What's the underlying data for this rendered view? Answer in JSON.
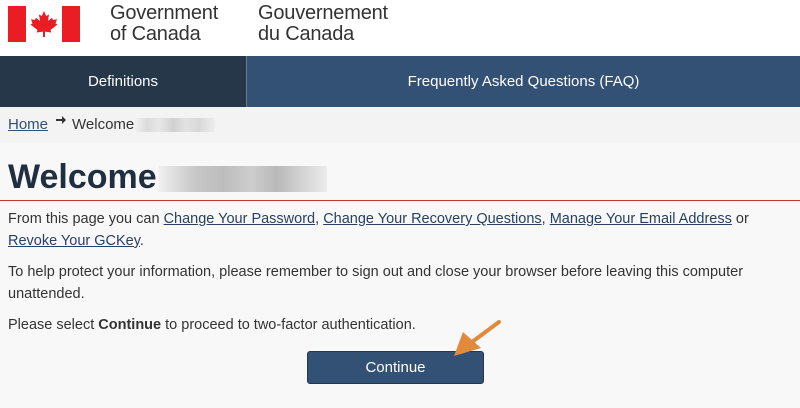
{
  "header": {
    "wordmark_en": [
      "Government",
      "of Canada"
    ],
    "wordmark_fr": [
      "Gouvernement",
      "du Canada"
    ],
    "flag_icon": "canada-flag-icon",
    "colors": {
      "flag_red": "#ea1c24"
    }
  },
  "nav": {
    "items": [
      {
        "label": "Definitions",
        "active": true
      },
      {
        "label": "Frequently Asked Questions (FAQ)",
        "active": false
      }
    ],
    "colors": {
      "bar": "#335075",
      "active": "#26374a"
    }
  },
  "breadcrumb": {
    "home": "Home",
    "separator_icon": "right-arrow-icon",
    "current": "Welcome"
  },
  "main": {
    "title": "Welcome",
    "rule_color": "#c9342c",
    "intro": {
      "prefix": "From this page you can ",
      "link1": "Change Your Password",
      "sep1": ", ",
      "link2": "Change Your Recovery Questions",
      "sep2": ", ",
      "link3": "Manage Your Email Address",
      "sep3": " or ",
      "link4": "Revoke Your GCKey",
      "suffix": "."
    },
    "protect_text": "To help protect your information, please remember to sign out and close your browser before leaving this computer unattended.",
    "select": {
      "prefix": "Please select ",
      "bold": "Continue",
      "suffix": " to proceed to two-factor authentication."
    },
    "continue_label": "Continue"
  },
  "annotation": {
    "icon": "pointer-arrow-icon",
    "color": "#e08a3c"
  }
}
